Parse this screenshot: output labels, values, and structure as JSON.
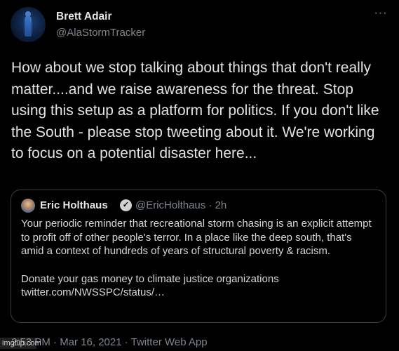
{
  "tweet": {
    "author": {
      "display_name": "Brett Adair",
      "handle": "@AlaStormTracker",
      "avatar_icon": "avatar-photo"
    },
    "more_icon": "ellipsis-icon",
    "more_glyph": "···",
    "text": "How about we stop talking about things that don't really matter....and we raise awareness for the threat.  Stop using this setup as a platform for politics.  If you don't like the South - please stop tweeting about it.  We're working to focus on a potential disaster here...",
    "quoted": {
      "display_name": "Eric Holthaus",
      "verified_glyph": "✓",
      "handle_time": "@EricHolthaus · 2h",
      "paragraph_1": "Your periodic reminder that recreational storm chasing is an explicit attempt to profit off of other people's terror. In a place like the deep south, that's amid a context of hundreds of years of structural poverty & racism.",
      "paragraph_2": "Donate your gas money to climate justice organizations twitter.com/NWSSPC/status/…"
    },
    "meta": "2:53 PM · Mar 16, 2021 · Twitter Web App"
  },
  "watermark": "imgflip.com",
  "colors": {
    "background": "#000000",
    "primary_text": "#e2e2e2",
    "secondary_text": "#7e858c",
    "border": "#3a3e42"
  }
}
